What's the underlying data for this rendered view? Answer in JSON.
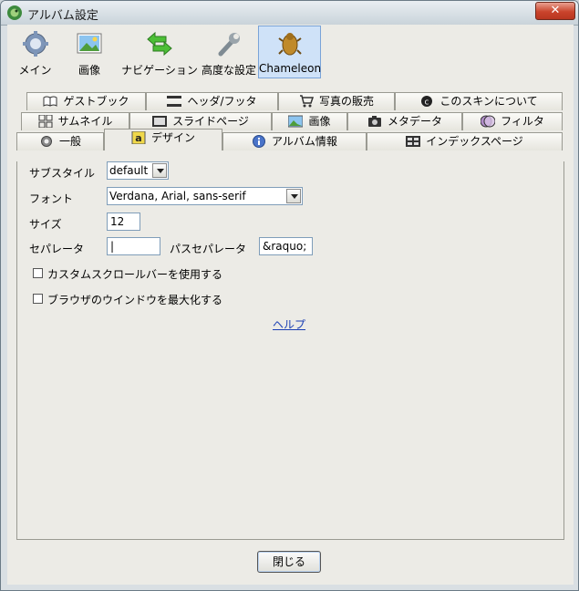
{
  "window": {
    "title": "アルバム設定",
    "close_glyph": "✕",
    "close_color": "#c9442c"
  },
  "toolbar": {
    "items": [
      {
        "label": "メイン",
        "icon": "gear-icon"
      },
      {
        "label": "画像",
        "icon": "image-icon"
      },
      {
        "label": "ナビゲーション",
        "icon": "arrows-icon"
      },
      {
        "label": "高度な設定",
        "icon": "wrench-icon"
      },
      {
        "label": "Chameleon",
        "icon": "chameleon-icon",
        "selected": true
      }
    ]
  },
  "tabs": {
    "row1": [
      "ゲストブック",
      "ヘッダ/フッタ",
      "写真の販売",
      "このスキンについて"
    ],
    "row2": [
      "サムネイル",
      "スライドページ",
      "画像",
      "メタデータ",
      "フィルタ"
    ],
    "row3": [
      "一般",
      "デザイン",
      "アルバム情報",
      "インデックスページ"
    ],
    "active": "デザイン"
  },
  "form": {
    "substyle_label": "サブスタイル",
    "substyle_value": "default",
    "font_label": "フォント",
    "font_value": "Verdana, Arial, sans-serif",
    "size_label": "サイズ",
    "size_value": "12",
    "separator_label": "セパレータ",
    "separator_value": "|",
    "path_separator_label": "パスセパレータ",
    "path_separator_value": "&raquo;",
    "custom_scrollbar_label": "カスタムスクロールバーを使用する",
    "custom_scrollbar_checked": false,
    "maximize_window_label": "ブラウザのウインドウを最大化する",
    "maximize_window_checked": false,
    "help_link": "ヘルプ"
  },
  "footer": {
    "close_button": "閉じる"
  }
}
